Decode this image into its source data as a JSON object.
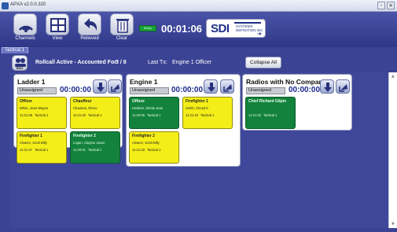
{
  "window": {
    "title": "APXA v2.0.0.320",
    "minimize": "-",
    "close": "×"
  },
  "toolbar": {
    "buttons": [
      {
        "label": "Channels",
        "icon": "radio-icon"
      },
      {
        "label": "View",
        "icon": "grid-view-icon"
      },
      {
        "label": "Relieved",
        "icon": "undo-arrow-icon"
      },
      {
        "label": "Clear",
        "icon": "trash-icon"
      }
    ],
    "status_badge": "Ready",
    "elapsed_timer": "00:01:06",
    "logo": {
      "big": "SDI",
      "small": "SYSTEMS DEFINITION INC"
    }
  },
  "tabs": [
    {
      "label": "Tactical 1",
      "active": true
    }
  ],
  "rollcall": {
    "end_label": "END",
    "status_text": "Rollcall Active - Accounted For:",
    "count": "3 / 8",
    "last_tx_label": "Last Tx:",
    "last_tx_value": "Engine 1 Officer",
    "collapse_label": "Collapse All"
  },
  "panels": [
    {
      "name": "Ladder 1",
      "assignment": "Unassigned",
      "timer": "00:00:00",
      "cards": [
        {
          "role": "Officer",
          "person": "White, Jean Wayne",
          "time": "11:21:38",
          "channel": "Tactical 1",
          "status": "yellow"
        },
        {
          "role": "Chauffeur",
          "person": "Chauhan, Dhruv",
          "time": "11:21:40",
          "channel": "Tactical 1",
          "status": "yellow"
        },
        {
          "role": "Firefighter 1",
          "person": "Alvarez, Scott Billy",
          "time": "11:21:47",
          "channel": "Tactical 1",
          "status": "yellow"
        },
        {
          "role": "Firefighter 2",
          "person": "Logan, Clayton Jason",
          "time": "11:20:01",
          "channel": "Tactical 1",
          "status": "green"
        }
      ]
    },
    {
      "name": "Engine 1",
      "assignment": "Unassigned",
      "timer": "00:00:00",
      "cards": [
        {
          "role": "Officer",
          "person": "Hoskins, Sheila Jean",
          "time": "11:20:06",
          "channel": "Tactical 1",
          "status": "green"
        },
        {
          "role": "Firefighter 1",
          "person": "Smith, Cheryl K",
          "time": "11:21:10",
          "channel": "Tactical 1",
          "status": "yellow"
        },
        {
          "role": "Firefighter 2",
          "person": "Alvarez, Scott Billy",
          "time": "11:21:33",
          "channel": "Tactical 1",
          "status": "yellow"
        }
      ]
    },
    {
      "name": "Radios with No Company",
      "assignment": "Unassigned",
      "timer": "00:00:00",
      "cards": [
        {
          "role": "Chief Richard Gilpin",
          "person": "",
          "time": "11:21:03",
          "channel": "Tactical 1",
          "status": "green"
        }
      ]
    }
  ],
  "colors": {
    "card_yellow": "#f4ee18",
    "card_green": "#12823d",
    "background": "#3b4394",
    "timer_blue": "#1c2a90"
  }
}
